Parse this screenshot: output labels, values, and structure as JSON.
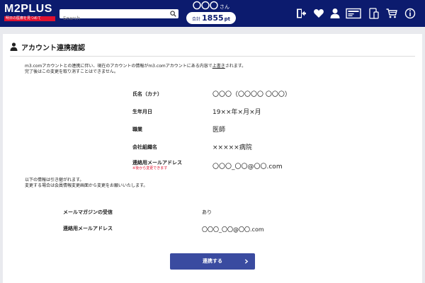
{
  "header": {
    "logo_text": "M2PLUS",
    "logo_tagline": "明日の医療を見つめて",
    "search_placeholder": "Search",
    "user_name": "〇〇〇",
    "user_suffix": "さん",
    "points_label": "合計",
    "points_value": "1855",
    "points_unit": "pt",
    "icons": [
      "logout-icon",
      "heart-icon",
      "user-icon",
      "card-icon",
      "device-icon",
      "cart-icon",
      "info-icon"
    ]
  },
  "page": {
    "title": "アカウント連携確認",
    "intro_line1_a": "m3.comアカウントとの連携に伴い、現在のアカウントの情報がm3.comアカウントにある内容で",
    "intro_line1_link": "上書き",
    "intro_line1_b": "されます。",
    "intro_line2": "完了後はこの変更を取り消すことはできません。",
    "fields": [
      {
        "label": "氏名（カナ）",
        "value": "〇〇〇（〇〇〇〇 〇〇〇）"
      },
      {
        "label": "生年月日",
        "value": "19××年×月×月"
      },
      {
        "label": "職業",
        "value": "医師"
      },
      {
        "label": "会社組織名",
        "value": "×××××病院"
      },
      {
        "label": "連絡用メールアドレス",
        "value": "〇〇〇_〇〇@〇〇.com",
        "note": "※後から変更できます"
      }
    ],
    "inherit_line1": "以下の情報は引き継がれます。",
    "inherit_line2": "変更する場合は会員情報変更画面から変更をお願いいたします。",
    "inherited": [
      {
        "label": "メールマガジンの受信",
        "value": "あり"
      },
      {
        "label": "連絡用メールアドレス",
        "value": "〇〇〇_〇〇@〇〇.com"
      }
    ],
    "submit_label": "連携する"
  },
  "colors": {
    "header_bg": "#0c1b6e",
    "accent_red": "#e0102e",
    "button_bg": "#3a4ba0",
    "page_bg": "#e9eaee"
  }
}
